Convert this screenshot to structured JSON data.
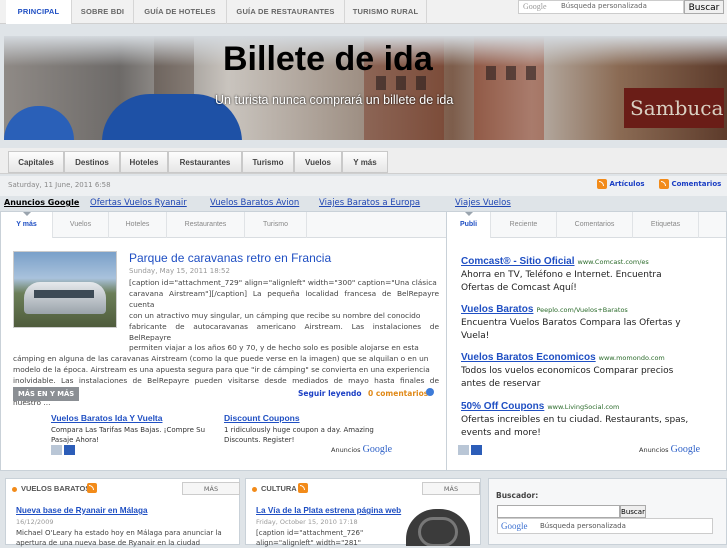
{
  "top_nav": {
    "tabs": [
      "PRINCIPAL",
      "SOBRE BDI",
      "GUÍA DE HOTELES",
      "GUÍA DE RESTAURANTES",
      "TURISMO RURAL"
    ],
    "search_google": "Google",
    "search_placeholder": "Búsqueda personalizada",
    "search_button": "Buscar"
  },
  "header": {
    "title": "Billete de ida",
    "tagline": "Un turista nunca comprará un billete de ida",
    "sign_text": "Sambuca"
  },
  "section_nav": [
    "Capitales",
    "Destinos",
    "Hoteles",
    "Restaurantes",
    "Turismo",
    "Vuelos",
    "Y más"
  ],
  "date_bar": {
    "date": "Saturday, 11 June, 2011 6:58",
    "feed_articles": "Artículos",
    "feed_comments": "Comentarios"
  },
  "ad_bar": {
    "label": "Anuncios Google",
    "links": [
      "Ofertas Vuelos Ryanair",
      "Vuelos Baratos Avion",
      "Viajes Baratos a Europa",
      "Viajes Vuelos"
    ]
  },
  "main_tabs": [
    "Y más",
    "Vuelos",
    "Hoteles",
    "Restaurantes",
    "Turismo"
  ],
  "post": {
    "title": "Parque de caravanas retro en Francia",
    "date": "Sunday, May 15, 2011 18:52",
    "body_lines": [
      "[caption id=\"attachment_729\" align=\"alignleft\" width=\"300\" caption=\"Una clásica",
      "caravana Airstream\"][/caption] La pequeña localidad francesa de BelRepayre cuenta",
      "con un atractivo muy singular, un cámping que recibe su nombre del conocido",
      "fabricante de autocaravanas americano Airstream. Las instalaciones de BelRepayre",
      "permiten viajar a los años 60 y 70, y de hecho solo es posible alojarse en esta",
      "cámping en alguna de las caravanas Airstream (como la que puede verse en la imagen) que se alquilan o en un",
      "modelo de la época. Airstream es una apuesta segura para que \"ir de cámping\" se convierta en una experiencia",
      "inolvidable. Las instalaciones de BelRepayre pueden visitarse desde mediados de mayo hasta finales de septiembre;",
      "nuestro ..."
    ],
    "more_tag": "MÁS EN Y MÁS",
    "read_more": "Seguir leyendo",
    "comments": "0 comentarios"
  },
  "main_ads": [
    {
      "title": "Vuelos Baratos Ida Y Vuelta",
      "desc_lines": [
        "Compara Las Tarifas Mas Bajas. ¡Compre Su",
        "Pasaje Ahora!"
      ]
    },
    {
      "title": "Discount Coupons",
      "desc_lines": [
        "1 ridiculously huge coupon a day. Amazing",
        "Discounts. Register!"
      ]
    }
  ],
  "ads_by": "Anuncios",
  "ads_by_google": "Google",
  "side_tabs": [
    "Publi",
    "Reciente",
    "Comentarios",
    "Etiquetas"
  ],
  "side_ads": [
    {
      "title": "Comcast® - Sitio Oficial",
      "url": "www.Comcast.com/es",
      "desc_lines": [
        "Ahorra en TV, Teléfono e Internet. Encuentra",
        "Ofertas de Comcast Aquí!"
      ]
    },
    {
      "title": "Vuelos Baratos",
      "url": "Peeplo.com/Vuelos+Baratos",
      "desc_lines": [
        "Encuentra Vuelos Baratos Compara las Ofertas y",
        "Vuela!"
      ]
    },
    {
      "title": "Vuelos Baratos Economicos",
      "url": "www.momondo.com",
      "desc_lines": [
        "Todos los vuelos economicos Comparar precios",
        "antes de reservar"
      ]
    },
    {
      "title": "50% Off Coupons",
      "url": "www.LivingSocial.com",
      "desc_lines": [
        "Ofertas increibles en tu ciudad. Restaurants, spas,",
        "events and more!"
      ]
    }
  ],
  "bottom_left": {
    "heading": "VUELOS BARATOS",
    "more": "MÁS",
    "title": "Nueva base de Ryanair en Málaga",
    "date": "16/12/2009",
    "text_lines": [
      "Michael O'Leary ha estado hoy en Málaga para anunciar la",
      "apertura de una nueva base de Ryanair en la ciudad"
    ]
  },
  "bottom_mid": {
    "heading": "CULTURA",
    "more": "MÁS",
    "title": "La Vía de la Plata estrena página web",
    "date": "Friday, October 15, 2010 17:18",
    "text_lines": [
      "[caption          id=\"attachment_726\"",
      "align=\"alignleft\"           width=\"281\""
    ]
  },
  "buscador": {
    "label": "Buscador:",
    "button": "Buscar",
    "google": "Google",
    "placeholder": "Búsqueda personalizada"
  }
}
